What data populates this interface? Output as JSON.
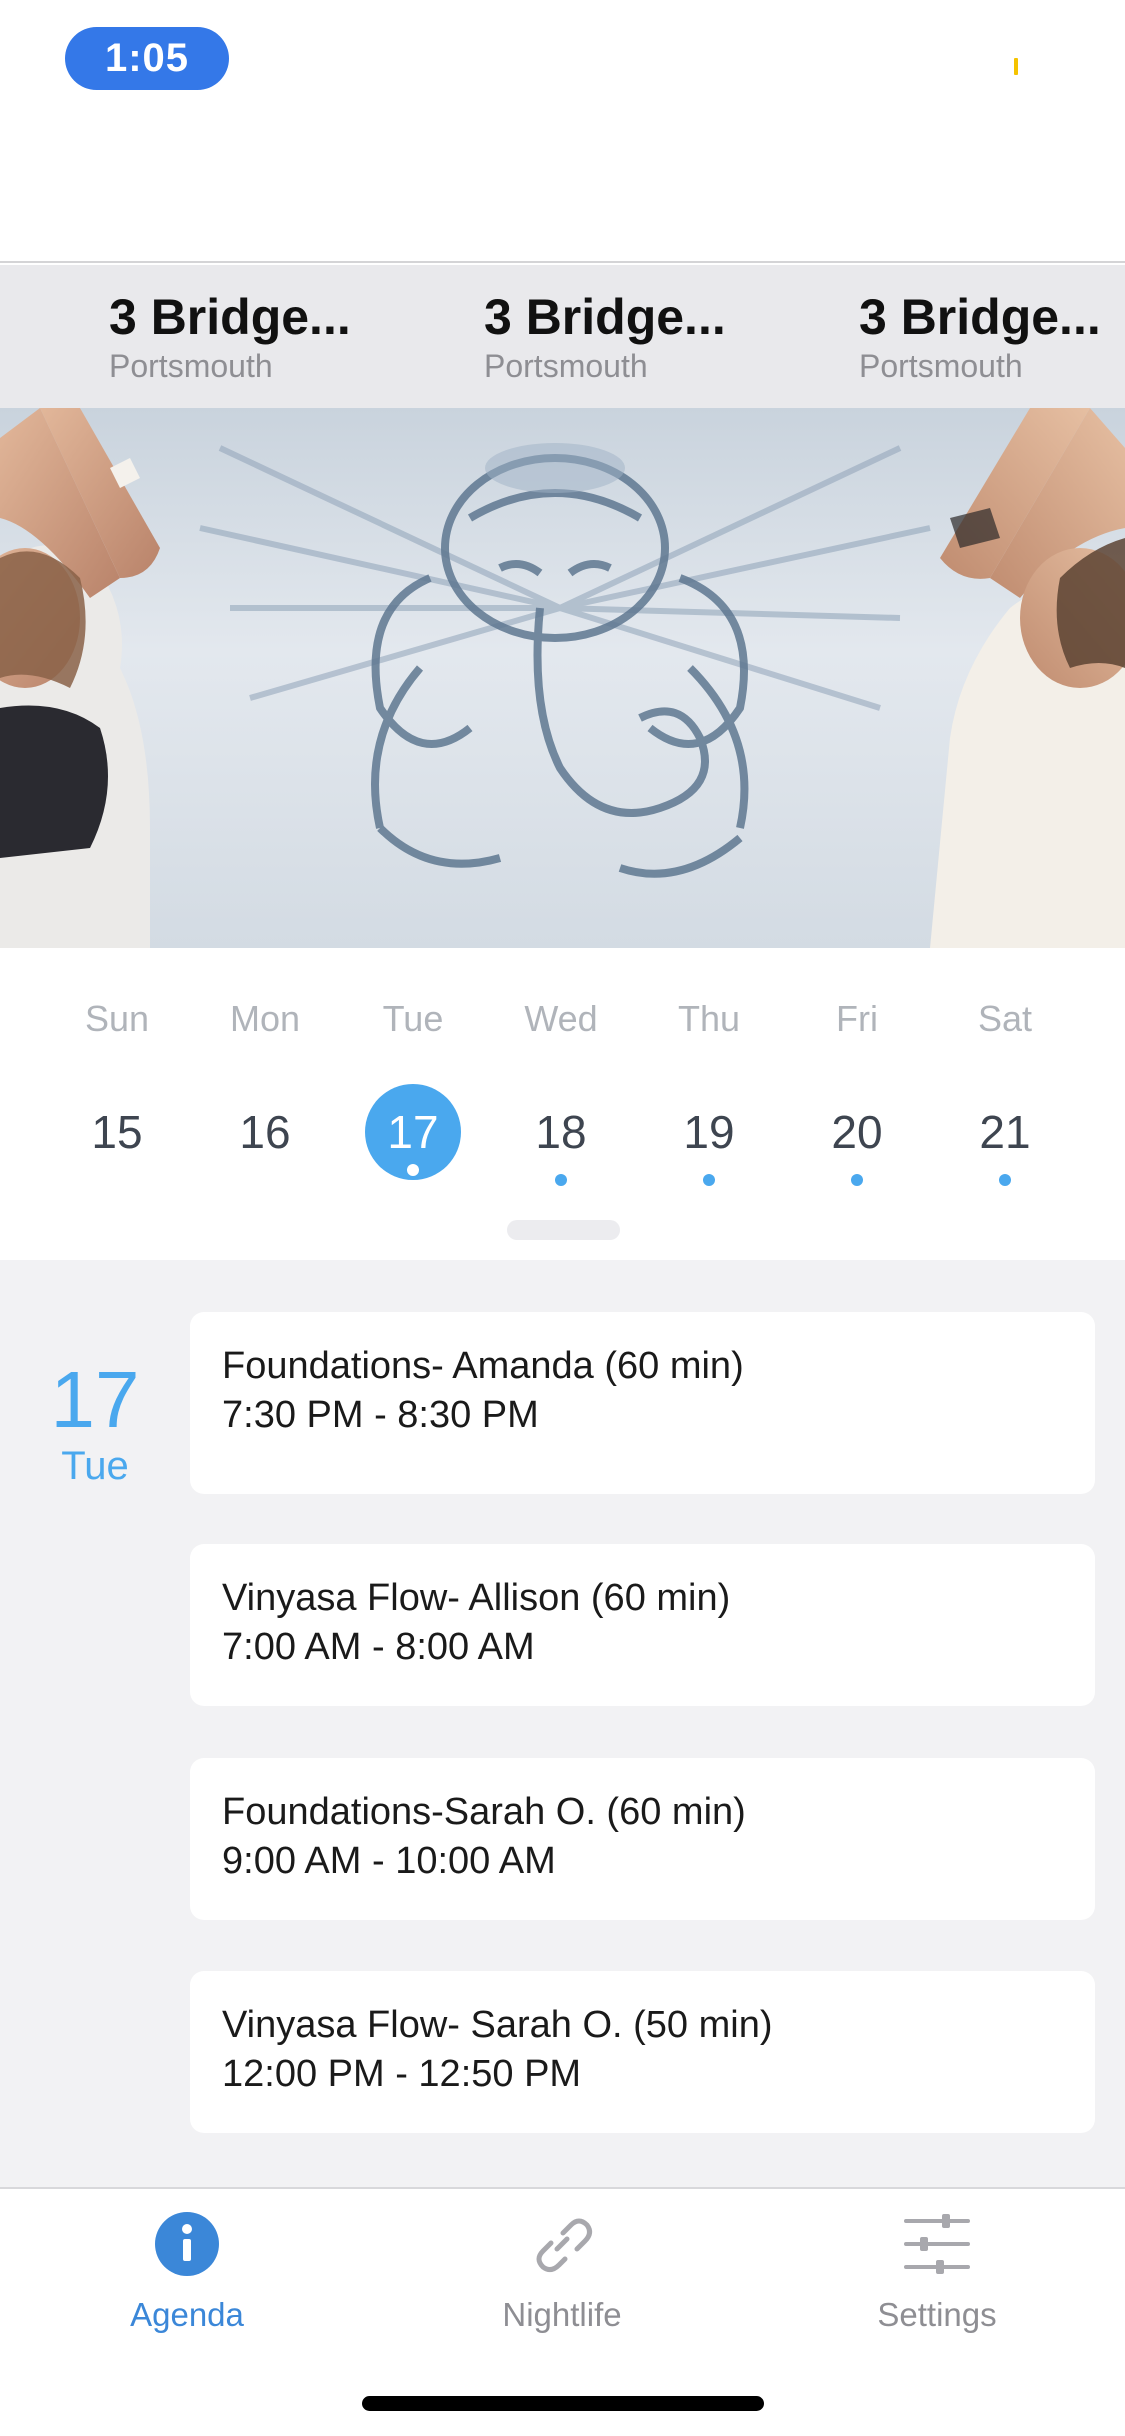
{
  "status_bar": {
    "time": "1:05"
  },
  "venues": [
    {
      "name": "3 Bridge...",
      "location": "Portsmouth"
    },
    {
      "name": "3 Bridge...",
      "location": "Portsmouth"
    },
    {
      "name": "3 Bridge...",
      "location": "Portsmouth"
    }
  ],
  "week": {
    "days": [
      {
        "name": "Sun",
        "num": "15",
        "selected": false,
        "has_events": false
      },
      {
        "name": "Mon",
        "num": "16",
        "selected": false,
        "has_events": false
      },
      {
        "name": "Tue",
        "num": "17",
        "selected": true,
        "has_events": true
      },
      {
        "name": "Wed",
        "num": "18",
        "selected": false,
        "has_events": true
      },
      {
        "name": "Thu",
        "num": "19",
        "selected": false,
        "has_events": true
      },
      {
        "name": "Fri",
        "num": "20",
        "selected": false,
        "has_events": true
      },
      {
        "name": "Sat",
        "num": "21",
        "selected": false,
        "has_events": true
      }
    ]
  },
  "agenda": {
    "date_num": "17",
    "date_dow": "Tue",
    "events": [
      {
        "title": "Foundations- Amanda (60 min)",
        "time": "7:30 PM - 8:30 PM"
      },
      {
        "title": "Vinyasa Flow- Allison (60 min)",
        "time": "7:00 AM - 8:00 AM"
      },
      {
        "title": "Foundations-Sarah O. (60 min)",
        "time": "9:00 AM - 10:00 AM"
      },
      {
        "title": "Vinyasa Flow- Sarah O. (50 min)",
        "time": "12:00 PM - 12:50 PM"
      }
    ]
  },
  "tabs": [
    {
      "label": "Agenda",
      "icon": "info-icon",
      "active": true
    },
    {
      "label": "Nightlife",
      "icon": "link-icon",
      "active": false
    },
    {
      "label": "Settings",
      "icon": "sliders-icon",
      "active": false
    }
  ],
  "colors": {
    "accent": "#4aa8ee",
    "tab_active": "#3b87d8",
    "status_pill": "#3478e8"
  }
}
